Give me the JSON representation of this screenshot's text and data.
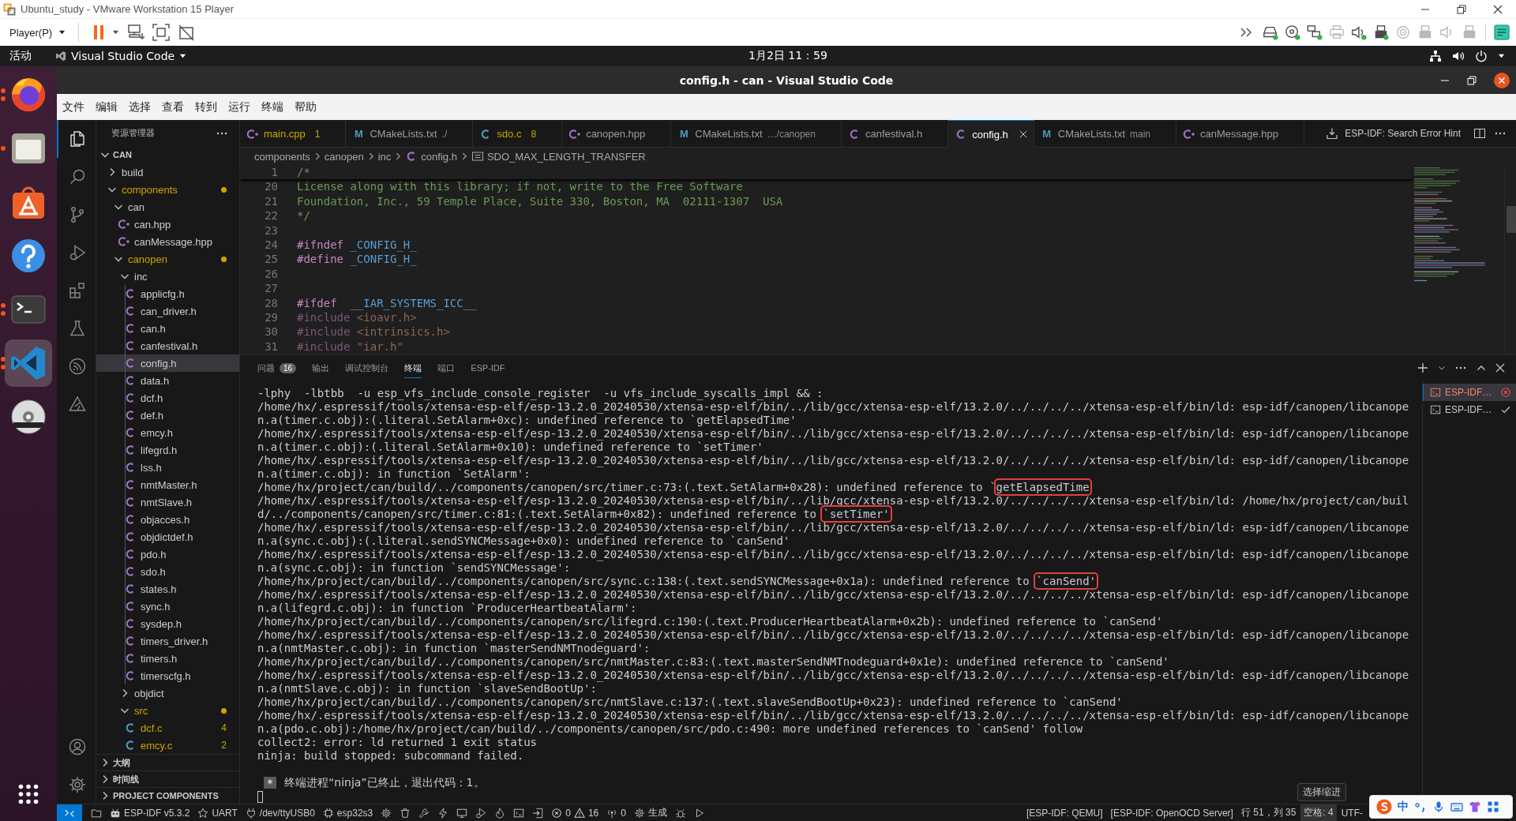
{
  "vm": {
    "title": "Ubuntu_study - VMware Workstation 15 Player",
    "menu": "Player(P)"
  },
  "vm_devices": [
    {
      "kind": "drive",
      "connected": true
    },
    {
      "kind": "disc",
      "connected": true
    },
    {
      "kind": "network",
      "connected": true
    },
    {
      "kind": "printer",
      "connected": false
    },
    {
      "kind": "sound",
      "connected": true
    },
    {
      "kind": "usb",
      "connected": true
    },
    {
      "kind": "target",
      "connected": false
    },
    {
      "kind": "usb",
      "connected": false
    },
    {
      "kind": "sound",
      "connected": false
    },
    {
      "kind": "usb",
      "connected": false
    }
  ],
  "top_bar": {
    "activities": "活动",
    "app": "Visual Studio Code",
    "clock": "1月2日 11：59"
  },
  "dock": [
    {
      "kind": "browser",
      "running": true,
      "multiple": true,
      "selected": false
    },
    {
      "kind": "files",
      "running": true,
      "multiple": false,
      "selected": false
    },
    {
      "kind": "store",
      "running": false,
      "selected": false
    },
    {
      "kind": "help",
      "running": false,
      "selected": false
    },
    {
      "kind": "terminal",
      "running": true,
      "multiple": true,
      "selected": false
    },
    {
      "kind": "code",
      "running": true,
      "multiple": true,
      "selected": true
    },
    {
      "kind": "disc",
      "running": false,
      "selected": false
    }
  ],
  "window": {
    "title": "config.h - can - Visual Studio Code"
  },
  "menu": [
    "文件",
    "编辑",
    "选择",
    "查看",
    "转到",
    "运行",
    "终端",
    "帮助"
  ],
  "activity_bar": {
    "top": [
      {
        "kind": "explorer",
        "selected": true
      },
      {
        "kind": "search",
        "selected": false
      },
      {
        "kind": "scm",
        "selected": false
      },
      {
        "kind": "debug",
        "selected": false
      },
      {
        "kind": "extensions",
        "selected": false
      },
      {
        "kind": "testing",
        "selected": false
      },
      {
        "kind": "espressif",
        "selected": false
      },
      {
        "kind": "tool",
        "selected": false
      }
    ],
    "bottom": [
      {
        "kind": "account",
        "selected": false
      },
      {
        "kind": "settings",
        "selected": false
      }
    ]
  },
  "explorer": {
    "title": "资源管理器",
    "root": "CAN",
    "root_expanded": true,
    "tree": [
      {
        "name": "build",
        "kind": "folder",
        "expanded": false,
        "selected": false,
        "warning": false
      },
      {
        "name": "components",
        "kind": "folder",
        "expanded": true,
        "selected": false,
        "warning": true,
        "children": [
          {
            "name": "can",
            "kind": "folder",
            "expanded": true,
            "selected": false,
            "warning": false,
            "children": [
              {
                "name": "can.hpp",
                "kind": "cpp",
                "selected": false,
                "warning": false
              },
              {
                "name": "canMessage.hpp",
                "kind": "cpp",
                "selected": false,
                "warning": false
              }
            ]
          },
          {
            "name": "canopen",
            "kind": "folder",
            "expanded": true,
            "selected": false,
            "warning": true,
            "children": [
              {
                "name": "inc",
                "kind": "folder",
                "expanded": true,
                "selected": false,
                "warning": false,
                "children": [
                  {
                    "name": "applicfg.h",
                    "kind": "header",
                    "selected": false,
                    "warning": false
                  },
                  {
                    "name": "can_driver.h",
                    "kind": "header",
                    "selected": false,
                    "warning": false
                  },
                  {
                    "name": "can.h",
                    "kind": "header",
                    "selected": false,
                    "warning": false
                  },
                  {
                    "name": "canfestival.h",
                    "kind": "header",
                    "selected": false,
                    "warning": false
                  },
                  {
                    "name": "config.h",
                    "kind": "header",
                    "selected": true,
                    "warning": false
                  },
                  {
                    "name": "data.h",
                    "kind": "header",
                    "selected": false,
                    "warning": false
                  },
                  {
                    "name": "dcf.h",
                    "kind": "header",
                    "selected": false,
                    "warning": false
                  },
                  {
                    "name": "def.h",
                    "kind": "header",
                    "selected": false,
                    "warning": false
                  },
                  {
                    "name": "emcy.h",
                    "kind": "header",
                    "selected": false,
                    "warning": false
                  },
                  {
                    "name": "lifegrd.h",
                    "kind": "header",
                    "selected": false,
                    "warning": false
                  },
                  {
                    "name": "lss.h",
                    "kind": "header",
                    "selected": false,
                    "warning": false
                  },
                  {
                    "name": "nmtMaster.h",
                    "kind": "header",
                    "selected": false,
                    "warning": false
                  },
                  {
                    "name": "nmtSlave.h",
                    "kind": "header",
                    "selected": false,
                    "warning": false
                  },
                  {
                    "name": "objacces.h",
                    "kind": "header",
                    "selected": false,
                    "warning": false
                  },
                  {
                    "name": "objdictdef.h",
                    "kind": "header",
                    "selected": false,
                    "warning": false
                  },
                  {
                    "name": "pdo.h",
                    "kind": "header",
                    "selected": false,
                    "warning": false
                  },
                  {
                    "name": "sdo.h",
                    "kind": "header",
                    "selected": false,
                    "warning": false
                  },
                  {
                    "name": "states.h",
                    "kind": "header",
                    "selected": false,
                    "warning": false
                  },
                  {
                    "name": "sync.h",
                    "kind": "header",
                    "selected": false,
                    "warning": false
                  },
                  {
                    "name": "sysdep.h",
                    "kind": "header",
                    "selected": false,
                    "warning": false
                  },
                  {
                    "name": "timers_driver.h",
                    "kind": "header",
                    "selected": false,
                    "warning": false
                  },
                  {
                    "name": "timers.h",
                    "kind": "header",
                    "selected": false,
                    "warning": false
                  },
                  {
                    "name": "timerscfg.h",
                    "kind": "header",
                    "selected": false,
                    "warning": false
                  }
                ]
              },
              {
                "name": "objdict",
                "kind": "folder",
                "expanded": false,
                "selected": false,
                "warning": false
              },
              {
                "name": "src",
                "kind": "folder",
                "expanded": true,
                "selected": false,
                "warning": true,
                "children": [
                  {
                    "name": "dcf.c",
                    "kind": "source",
                    "selected": false,
                    "warning": true,
                    "badge": "4"
                  },
                  {
                    "name": "emcy.c",
                    "kind": "source",
                    "selected": false,
                    "warning": true,
                    "badge": "2"
                  }
                ]
              }
            ]
          }
        ]
      }
    ],
    "sections": [
      {
        "label": "大纲",
        "expanded": false
      },
      {
        "label": "时间线",
        "expanded": false
      },
      {
        "label": "PROJECT COMPONENTS",
        "expanded": false
      }
    ]
  },
  "tabs": [
    {
      "label": "main.cpp",
      "kind": "cpp",
      "badge": "1",
      "warning": true,
      "selected": false
    },
    {
      "label": "CMakeLists.txt",
      "kind": "cmake",
      "glyph": "M",
      "description": "./",
      "warning": false,
      "selected": false
    },
    {
      "label": "sdo.c",
      "kind": "source",
      "badge": "8",
      "warning": true,
      "selected": false
    },
    {
      "label": "canopen.hpp",
      "kind": "cpp",
      "warning": false,
      "selected": false
    },
    {
      "label": "CMakeLists.txt",
      "kind": "cmake",
      "glyph": "M",
      "description": "…/canopen",
      "warning": false,
      "selected": false
    },
    {
      "label": "canfestival.h",
      "kind": "header",
      "warning": false,
      "selected": false
    },
    {
      "label": "config.h",
      "kind": "header",
      "warning": false,
      "selected": true
    },
    {
      "label": "CMakeLists.txt",
      "kind": "cmake",
      "glyph": "M",
      "description": "main",
      "warning": false,
      "selected": false
    },
    {
      "label": "canMessage.hpp",
      "kind": "cpp",
      "warning": false,
      "selected": false
    }
  ],
  "editor_actions": {
    "hint": "ESP-IDF: Search Error Hint"
  },
  "breadcrumb": [
    {
      "label": "components",
      "kind": "folder"
    },
    {
      "label": "canopen",
      "kind": "folder"
    },
    {
      "label": "inc",
      "kind": "folder"
    },
    {
      "label": "config.h",
      "kind": "header"
    },
    {
      "label": "SDO_MAX_LENGTH_TRANSFER",
      "kind": "symbol"
    }
  ],
  "editor": {
    "sticky": {
      "number": "1",
      "tokens": [
        {
          "kind": "comment",
          "text": "/*"
        }
      ]
    },
    "lines": [
      {
        "number": "20",
        "tokens": [
          {
            "kind": "comment",
            "text": "License along with this library; if not, write to the Free Software"
          }
        ]
      },
      {
        "number": "21",
        "tokens": [
          {
            "kind": "comment",
            "text": "Foundation, Inc., 59 Temple Place, Suite 330, Boston, MA  02111-1307  USA"
          }
        ]
      },
      {
        "number": "22",
        "tokens": [
          {
            "kind": "comment",
            "text": "*/"
          }
        ]
      },
      {
        "number": "23"
      },
      {
        "number": "24",
        "tokens": [
          {
            "kind": "directive",
            "text": "#ifndef "
          },
          {
            "kind": "macro",
            "text": "_CONFIG_H_"
          }
        ]
      },
      {
        "number": "25",
        "tokens": [
          {
            "kind": "directive",
            "text": "#define "
          },
          {
            "kind": "macro",
            "text": "_CONFIG_H_"
          }
        ]
      },
      {
        "number": "26"
      },
      {
        "number": "27"
      },
      {
        "number": "28",
        "tokens": [
          {
            "kind": "directive",
            "text": "#ifdef  "
          },
          {
            "kind": "macro",
            "text": "__IAR_SYSTEMS_ICC__"
          }
        ]
      },
      {
        "number": "29",
        "tokens": [
          {
            "kind": "inactive-directive",
            "text": "#include "
          },
          {
            "kind": "inactive-string",
            "text": "<ioavr.h>"
          }
        ]
      },
      {
        "number": "30",
        "tokens": [
          {
            "kind": "inactive-directive",
            "text": "#include "
          },
          {
            "kind": "inactive-string",
            "text": "<intrinsics.h>"
          }
        ]
      },
      {
        "number": "31",
        "tokens": [
          {
            "kind": "inactive-directive",
            "text": "#include "
          },
          {
            "kind": "inactive-string",
            "text": "\"iar.h\""
          }
        ]
      }
    ]
  },
  "panel": {
    "tabs": [
      {
        "label": "问题",
        "badge": "16",
        "selected": false
      },
      {
        "label": "输出",
        "selected": false
      },
      {
        "label": "调试控制台",
        "selected": false
      },
      {
        "label": "终端",
        "selected": true
      },
      {
        "label": "端口",
        "selected": false
      },
      {
        "label": "ESP-IDF",
        "selected": false
      }
    ],
    "terminal": {
      "lines": [
        {
          "text": "-lphy  -lbtbb  -u esp_vfs_include_console_register  -u vfs_include_syscalls_impl && :"
        },
        {
          "text": "/home/hx/.espressif/tools/xtensa-esp-elf/esp-13.2.0_20240530/xtensa-esp-elf/bin/../lib/gcc/xtensa-esp-elf/13.2.0/../../../../xtensa-esp-elf/bin/ld: esp-idf/canopen/libcanope"
        },
        {
          "text": "n.a(timer.c.obj):(.literal.SetAlarm+0xc): undefined reference to `getElapsedTime'"
        },
        {
          "text": "/home/hx/.espressif/tools/xtensa-esp-elf/esp-13.2.0_20240530/xtensa-esp-elf/bin/../lib/gcc/xtensa-esp-elf/13.2.0/../../../../xtensa-esp-elf/bin/ld: esp-idf/canopen/libcanope"
        },
        {
          "text": "n.a(timer.c.obj):(.literal.SetAlarm+0x10): undefined reference to `setTimer'"
        },
        {
          "text": "/home/hx/.espressif/tools/xtensa-esp-elf/esp-13.2.0_20240530/xtensa-esp-elf/bin/../lib/gcc/xtensa-esp-elf/13.2.0/../../../../xtensa-esp-elf/bin/ld: esp-idf/canopen/libcanope"
        },
        {
          "text": "n.a(timer.c.obj): in function `SetAlarm':"
        },
        {
          "text": "/home/hx/project/can/build/../components/canopen/src/timer.c:73:(.text.SetAlarm+0x28): undefined reference to `",
          "boxed": "getElapsedTime"
        },
        {
          "text": "/home/hx/.espressif/tools/xtensa-esp-elf/esp-13.2.0_20240530/xtensa-esp-elf/bin/../lib/gcc/xtensa-esp-elf/13.2.0/../../../../xtensa-esp-elf/bin/ld: /home/hx/project/can/buil"
        },
        {
          "text": "d/../components/canopen/src/timer.c:81:(.text.SetAlarm+0x82): undefined reference to ",
          "boxed": "`setTimer'"
        },
        {
          "text": "/home/hx/.espressif/tools/xtensa-esp-elf/esp-13.2.0_20240530/xtensa-esp-elf/bin/../lib/gcc/xtensa-esp-elf/13.2.0/../../../../xtensa-esp-elf/bin/ld: esp-idf/canopen/libcanope"
        },
        {
          "text": "n.a(sync.c.obj):(.literal.sendSYNCMessage+0x0): undefined reference to `canSend'"
        },
        {
          "text": "/home/hx/.espressif/tools/xtensa-esp-elf/esp-13.2.0_20240530/xtensa-esp-elf/bin/../lib/gcc/xtensa-esp-elf/13.2.0/../../../../xtensa-esp-elf/bin/ld: esp-idf/canopen/libcanope"
        },
        {
          "text": "n.a(sync.c.obj): in function `sendSYNCMessage':"
        },
        {
          "text": "/home/hx/project/can/build/../components/canopen/src/sync.c:138:(.text.sendSYNCMessage+0x1a): undefined reference to ",
          "boxed": "`canSend'"
        },
        {
          "text": "/home/hx/.espressif/tools/xtensa-esp-elf/esp-13.2.0_20240530/xtensa-esp-elf/bin/../lib/gcc/xtensa-esp-elf/13.2.0/../../../../xtensa-esp-elf/bin/ld: esp-idf/canopen/libcanope"
        },
        {
          "text": "n.a(lifegrd.c.obj): in function `ProducerHeartbeatAlarm':"
        },
        {
          "text": "/home/hx/project/can/build/../components/canopen/src/lifegrd.c:190:(.text.ProducerHeartbeatAlarm+0x2b): undefined reference to `canSend'"
        },
        {
          "text": "/home/hx/.espressif/tools/xtensa-esp-elf/esp-13.2.0_20240530/xtensa-esp-elf/bin/../lib/gcc/xtensa-esp-elf/13.2.0/../../../../xtensa-esp-elf/bin/ld: esp-idf/canopen/libcanope"
        },
        {
          "text": "n.a(nmtMaster.c.obj): in function `masterSendNMTnodeguard':"
        },
        {
          "text": "/home/hx/project/can/build/../components/canopen/src/nmtMaster.c:83:(.text.masterSendNMTnodeguard+0x1e): undefined reference to `canSend'"
        },
        {
          "text": "/home/hx/.espressif/tools/xtensa-esp-elf/esp-13.2.0_20240530/xtensa-esp-elf/bin/../lib/gcc/xtensa-esp-elf/13.2.0/../../../../xtensa-esp-elf/bin/ld: esp-idf/canopen/libcanope"
        },
        {
          "text": "n.a(nmtSlave.c.obj): in function `slaveSendBootUp':"
        },
        {
          "text": "/home/hx/project/can/build/../components/canopen/src/nmtSlave.c:137:(.text.slaveSendBootUp+0x23): undefined reference to `canSend'"
        },
        {
          "text": "/home/hx/.espressif/tools/xtensa-esp-elf/esp-13.2.0_20240530/xtensa-esp-elf/bin/../lib/gcc/xtensa-esp-elf/13.2.0/../../../../xtensa-esp-elf/bin/ld: esp-idf/canopen/libcanope"
        },
        {
          "text": "n.a(pdo.c.obj):/home/hx/project/can/build/../components/canopen/src/pdo.c:490: more undefined references to `canSend' follow"
        },
        {
          "text": "collect2: error: ld returned 1 exit status"
        },
        {
          "text": "ninja: build stopped: subcommand failed."
        }
      ],
      "exit": {
        "marker": "*",
        "text": "终端进程“ninja”已终止，退出代码：1。"
      }
    },
    "terminals": [
      {
        "label": "ESP-IDF…",
        "error": true,
        "selected": true
      },
      {
        "label": "ESP-IDF…",
        "error": false,
        "selected": false
      }
    ]
  },
  "status_bar": {
    "left": [
      {
        "kind": "remote"
      },
      {
        "kind": "files"
      },
      {
        "kind": "idf",
        "text": "ESP-IDF v5.3.2"
      },
      {
        "kind": "star",
        "text": "UART"
      },
      {
        "kind": "plug",
        "text": "/dev/ttyUSB0"
      },
      {
        "kind": "chip",
        "text": "esp32s3"
      },
      {
        "kind": "gear"
      },
      {
        "kind": "trash"
      },
      {
        "kind": "wrench"
      },
      {
        "kind": "flash"
      },
      {
        "kind": "monitor"
      },
      {
        "kind": "debugrun"
      },
      {
        "kind": "flame"
      },
      {
        "kind": "terminal"
      },
      {
        "kind": "enter"
      },
      {
        "kind": "problems",
        "errors": "0",
        "warnings": "16"
      },
      {
        "kind": "radio",
        "text": "0"
      },
      {
        "kind": "build",
        "text": "生成"
      },
      {
        "kind": "bug"
      },
      {
        "kind": "run"
      }
    ],
    "right": [
      {
        "text": "[ESP-IDF: QEMU]",
        "hovered": false
      },
      {
        "text": "[ESP-IDF: OpenOCD Server]",
        "hovered": false
      },
      {
        "text": "行 51，列 35",
        "hovered": false
      },
      {
        "text": "空格: 4",
        "hovered": true,
        "tooltip": "选择缩进"
      },
      {
        "text": "UTF-",
        "hovered": false
      }
    ]
  },
  "ime": {
    "mode": "中"
  }
}
